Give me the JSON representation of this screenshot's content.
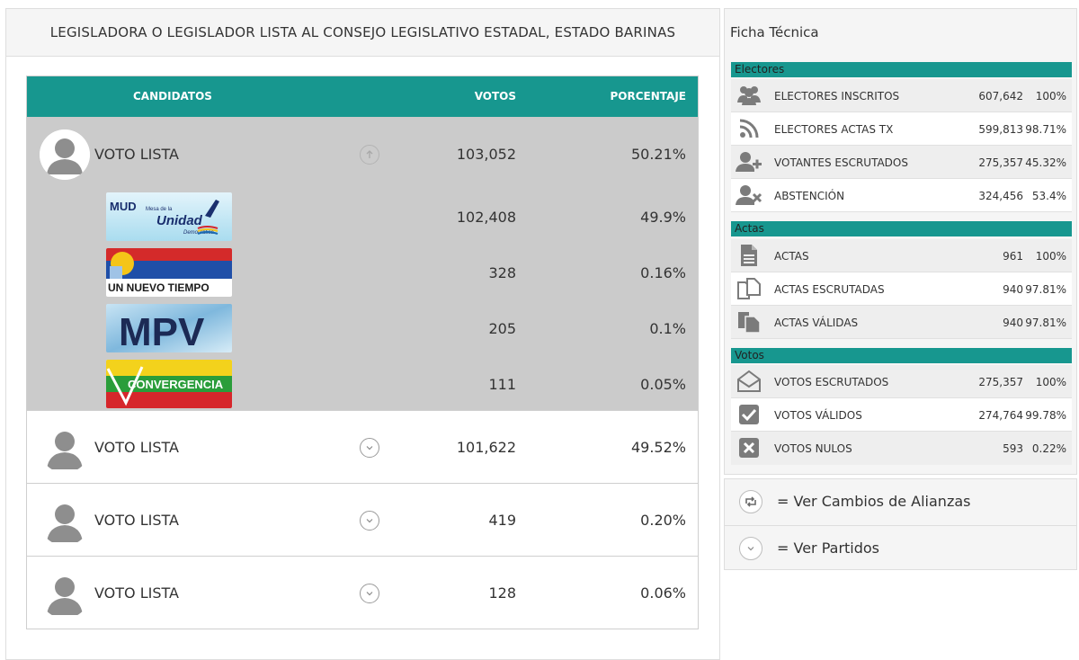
{
  "left_header": {
    "title": "LEGISLADORA O LEGISLADOR LISTA AL CONSEJO LEGISLATIVO ESTADAL, ESTADO BARINAS"
  },
  "table": {
    "col_candidatos": "CANDIDATOS",
    "col_votos": "VOTOS",
    "col_porcentaje": "PORCENTAJE"
  },
  "candidates": [
    {
      "name": "VOTO LISTA",
      "votes": "103,052",
      "percent": "50.21%",
      "expanded": true,
      "parties": [
        {
          "logo": "mud-logo",
          "logo_text": "MUD",
          "logo_sub1": "Mesa de la",
          "logo_sub2": "Unidad",
          "logo_sub3": "Democrática",
          "votes": "102,408",
          "percent": "49.9%"
        },
        {
          "logo": "un-nuevo-tiempo-logo",
          "logo_text": "UN NUEVO TIEMPO",
          "votes": "328",
          "percent": "0.16%"
        },
        {
          "logo": "mpv-logo",
          "logo_text": "MPV",
          "votes": "205",
          "percent": "0.1%"
        },
        {
          "logo": "convergencia-logo",
          "logo_text": "CONVERGENCIA",
          "votes": "111",
          "percent": "0.05%"
        }
      ]
    },
    {
      "name": "VOTO LISTA",
      "votes": "101,622",
      "percent": "49.52%",
      "expanded": false
    },
    {
      "name": "VOTO LISTA",
      "votes": "419",
      "percent": "0.20%",
      "expanded": false
    },
    {
      "name": "VOTO LISTA",
      "votes": "128",
      "percent": "0.06%",
      "expanded": false
    }
  ],
  "ficha": {
    "title": "Ficha Técnica",
    "electores": {
      "label": "Electores",
      "rows": [
        {
          "icon": "users-icon",
          "label": "ELECTORES INSCRITOS",
          "value": "607,642",
          "pct": "100%"
        },
        {
          "icon": "rss-icon",
          "label": "ELECTORES ACTAS TX",
          "value": "599,813",
          "pct": "98.71%"
        },
        {
          "icon": "user-plus-icon",
          "label": "VOTANTES ESCRUTADOS",
          "value": "275,357",
          "pct": "45.32%"
        },
        {
          "icon": "user-times-icon",
          "label": "ABSTENCIÓN",
          "value": "324,456",
          "pct": "53.4%"
        }
      ]
    },
    "actas": {
      "label": "Actas",
      "rows": [
        {
          "icon": "file-icon",
          "label": "ACTAS",
          "value": "961",
          "pct": "100%"
        },
        {
          "icon": "files-icon",
          "label": "ACTAS ESCRUTADAS",
          "value": "940",
          "pct": "97.81%"
        },
        {
          "icon": "file-copy-icon",
          "label": "ACTAS VÁLIDAS",
          "value": "940",
          "pct": "97.81%"
        }
      ]
    },
    "votos": {
      "label": "Votos",
      "rows": [
        {
          "icon": "envelope-open-icon",
          "label": "VOTOS ESCRUTADOS",
          "value": "275,357",
          "pct": "100%"
        },
        {
          "icon": "check-square-icon",
          "label": "VOTOS VÁLIDOS",
          "value": "274,764",
          "pct": "99.78%"
        },
        {
          "icon": "close-square-icon",
          "label": "VOTOS NULOS",
          "value": "593",
          "pct": "0.22%"
        }
      ]
    }
  },
  "actions": {
    "alianzas": "= Ver Cambios de Alianzas",
    "partidos": "= Ver Partidos"
  }
}
